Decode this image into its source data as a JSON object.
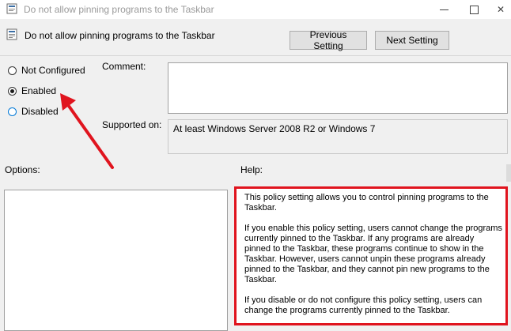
{
  "window": {
    "title": "Do not allow pinning programs to the Taskbar",
    "controls": {
      "minimize": "minimize",
      "maximize": "maximize",
      "close": "✕"
    }
  },
  "header": {
    "title": "Do not allow pinning programs to the Taskbar",
    "previous_button": "Previous Setting",
    "next_button": "Next Setting"
  },
  "state": {
    "options": [
      {
        "label": "Not Configured",
        "checked": false
      },
      {
        "label": "Enabled",
        "checked": true
      },
      {
        "label": "Disabled",
        "checked": false
      }
    ]
  },
  "comment": {
    "label": "Comment:",
    "value": ""
  },
  "supported": {
    "label": "Supported on:",
    "value": "At least Windows Server 2008 R2 or Windows 7"
  },
  "options_section": {
    "label": "Options:"
  },
  "help_section": {
    "label": "Help:",
    "paragraphs": [
      "This policy setting allows you to control pinning programs to the Taskbar.",
      "If you enable this policy setting, users cannot change the programs currently pinned to the Taskbar. If any programs are already pinned to the Taskbar, these programs continue to show in the Taskbar. However, users cannot unpin these programs already pinned to the Taskbar, and they cannot pin new programs to the Taskbar.",
      "If you disable or do not configure this policy setting, users can change the programs currently pinned to the Taskbar."
    ]
  },
  "colors": {
    "highlight_border": "#e0141e",
    "arrow": "#e0141e",
    "window_bg": "#f0f0f0"
  }
}
